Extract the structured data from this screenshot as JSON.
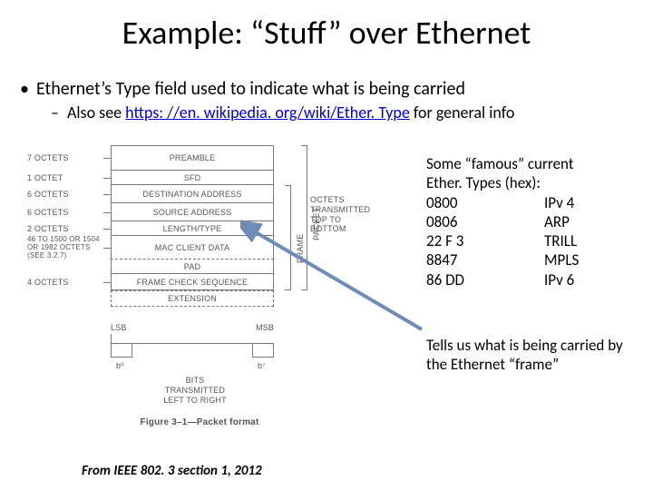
{
  "title": "Example: “Stuff” over Ethernet",
  "bullet1": "Ethernet’s Type field used to indicate what is being carried",
  "bullet2_pre": "Also see ",
  "bullet2_link": "https: //en. wikipedia. org/wiki/Ether. Type",
  "bullet2_post": " for general info",
  "diagram": {
    "rows": [
      {
        "o": "7 OCTETS",
        "f": "PREAMBLE"
      },
      {
        "o": "1 OCTET",
        "f": "SFD"
      },
      {
        "o": "6 OCTETS",
        "f": "DESTINATION ADDRESS"
      },
      {
        "o": "6 OCTETS",
        "f": "SOURCE ADDRESS"
      },
      {
        "o": "2 OCTETS",
        "f": "LENGTH/TYPE"
      },
      {
        "o": "46 TO 1500 OR 1504\nOR 1982 OCTETS\n(SEE 3.2.7)",
        "f": "MAC CLIENT DATA"
      },
      {
        "o": "",
        "f": "PAD"
      },
      {
        "o": "4 OCTETS",
        "f": "FRAME CHECK SEQUENCE"
      },
      {
        "o": "",
        "f": "EXTENSION"
      }
    ],
    "brace1": "FRAME",
    "brace2": "PACKET",
    "side": "OCTETS\nTRANSMITTED\nTOP TO BOTTOM",
    "lsb": "LSB",
    "msb": "MSB",
    "b0": "b⁰",
    "b7": "b⁷",
    "bitnote": "BITS\nTRANSMITTED\nLEFT TO RIGHT",
    "caption": "Figure 3–1—Packet format"
  },
  "etypes": {
    "hdr1": "Some “famous” current",
    "hdr2": "Ether. Types (hex):",
    "rows": [
      {
        "hex": "0800",
        "name": "IPv 4"
      },
      {
        "hex": "0806",
        "name": "ARP"
      },
      {
        "hex": "22 F 3",
        "name": "TRILL"
      },
      {
        "hex": "8847",
        "name": "MPLS"
      },
      {
        "hex": "86 DD",
        "name": "IPv 6"
      }
    ]
  },
  "tells": "Tells us what is being carried by the Ethernet “frame”",
  "source": "From IEEE 802. 3 section 1, 2012"
}
